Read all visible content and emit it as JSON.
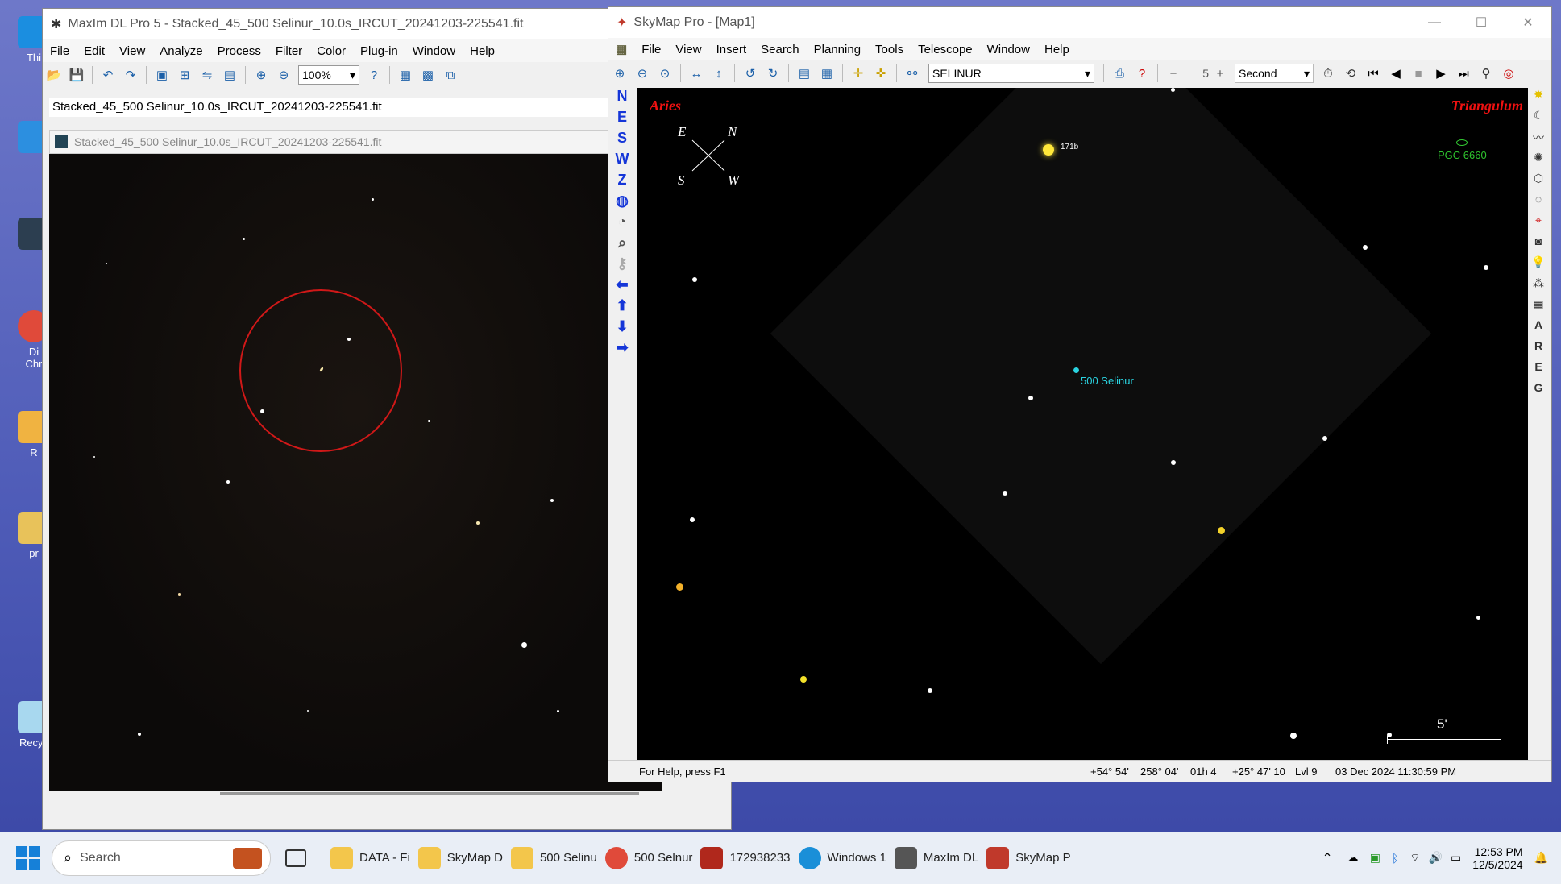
{
  "desktop": {
    "icons": [
      {
        "label": "Thi",
        "color": "#1b8ee0"
      },
      {
        "label": "",
        "color": "#2c3e50"
      },
      {
        "label": "Di\nChr",
        "color": "#e04a3a"
      },
      {
        "label": "R",
        "color": "#f0b341"
      },
      {
        "label": "pr",
        "color": "#e8c25a"
      },
      {
        "label": "Recyc",
        "color": "#a8d8ef"
      }
    ]
  },
  "maxim": {
    "title": "MaxIm DL Pro 5 - Stacked_45_500 Selinur_10.0s_IRCUT_20241203-225541.fit",
    "menu": [
      "File",
      "Edit",
      "View",
      "Analyze",
      "Process",
      "Filter",
      "Color",
      "Plug-in",
      "Window",
      "Help"
    ],
    "zoom": "100%",
    "info_line": "Stacked_45_500 Selinur_10.0s_IRCUT_20241203-225541.fit",
    "image_title": "Stacked_45_500 Selinur_10.0s_IRCUT_20241203-225541.fit"
  },
  "skymap": {
    "title": "SkyMap Pro - [Map1]",
    "menu": [
      "File",
      "View",
      "Insert",
      "Search",
      "Planning",
      "Tools",
      "Telescope",
      "Window",
      "Help"
    ],
    "search_value": "SELINUR",
    "step_value": "5",
    "step_unit": "Second",
    "left_tools": [
      "N",
      "E",
      "S",
      "W",
      "Z"
    ],
    "right_tools": [
      "A",
      "R",
      "E",
      "G"
    ],
    "constellation_left": "Aries",
    "constellation_right": "Triangulum",
    "compass": {
      "E": "E",
      "N": "N",
      "S": "S",
      "W": "W"
    },
    "labels": {
      "star_171": "171b",
      "galaxy": "PGC 6660",
      "asteroid": "500 Selinur",
      "scale": "5'"
    },
    "status": {
      "help": "For Help, press F1",
      "coords1": "+54° 54'",
      "coords2": "258° 04'",
      "coords3": "01h 4",
      "coords4": "+25° 47' 10",
      "level": "Lvl 9",
      "datetime": "03 Dec 2024 11:30:59 PM"
    }
  },
  "taskbar": {
    "search_placeholder": "Search",
    "items": [
      {
        "label": "DATA - Fi",
        "color": "#f3c64b"
      },
      {
        "label": "SkyMap D",
        "color": "#f3c64b"
      },
      {
        "label": "500 Selinu",
        "color": "#f3c64b"
      },
      {
        "label": "500 Selnur",
        "color": "#e04a3a"
      },
      {
        "label": "172938233",
        "color": "#b0281c"
      },
      {
        "label": "Windows 1",
        "color": "#1a8fd8"
      },
      {
        "label": "MaxIm DL",
        "color": "#555555"
      },
      {
        "label": "SkyMap P",
        "color": "#c0392b"
      }
    ],
    "time": "12:53 PM",
    "date": "12/5/2024"
  }
}
